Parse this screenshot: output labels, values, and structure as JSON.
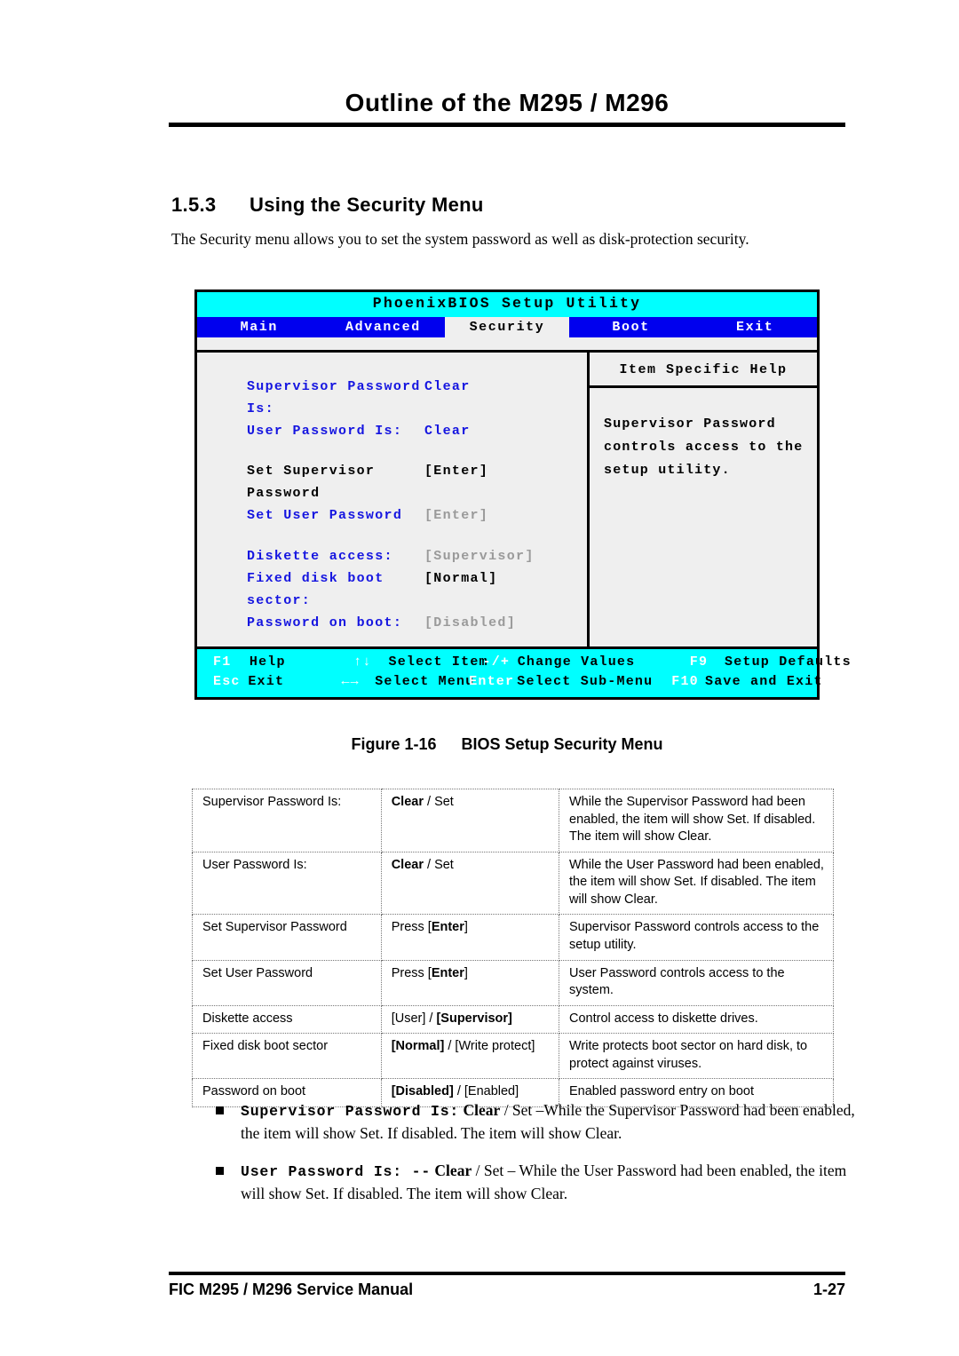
{
  "header": {
    "title": "Outline of the M295 / M296"
  },
  "section": {
    "number": "1.5.3",
    "heading": "Using the Security Menu",
    "intro": "The Security menu allows you to set the system password as well as disk-protection security."
  },
  "bios": {
    "utility_title": "PhoenixBIOS Setup Utility",
    "tabs": [
      {
        "label": "Main",
        "active": false
      },
      {
        "label": "Advanced",
        "active": false
      },
      {
        "label": "Security",
        "active": true
      },
      {
        "label": "Boot",
        "active": false
      },
      {
        "label": "Exit",
        "active": false
      }
    ],
    "items": [
      {
        "label": "Supervisor Password Is:",
        "value": "Clear",
        "label_color": "blue",
        "value_color": "blue"
      },
      {
        "label": "User Password Is:",
        "value": "Clear",
        "label_color": "blue",
        "value_color": "blue"
      },
      {
        "label": "Set Supervisor Password",
        "value": "[Enter]",
        "label_color": "black",
        "value_color": "black"
      },
      {
        "label": "Set User Password",
        "value": "[Enter]",
        "label_color": "blue",
        "value_color": "gray"
      },
      {
        "label": "Diskette access:",
        "value": "[Supervisor]",
        "label_color": "blue",
        "value_color": "gray"
      },
      {
        "label": "Fixed disk boot sector:",
        "value": "[Normal]",
        "label_color": "blue",
        "value_color": "black"
      },
      {
        "label": "Password on boot:",
        "value": "[Disabled]",
        "label_color": "blue",
        "value_color": "gray"
      }
    ],
    "help": {
      "title": "Item Specific Help",
      "lines": [
        "Supervisor Password",
        "controls access to the",
        "setup utility."
      ]
    },
    "fkeys": {
      "row1": [
        {
          "key": "F1",
          "desc": "Help"
        },
        {
          "key": "↑↓",
          "desc": "Select Item"
        },
        {
          "key": "-/+",
          "desc": "Change Values"
        },
        {
          "key": "F9",
          "desc": "Setup Defaults"
        }
      ],
      "row2": [
        {
          "key": "Esc",
          "desc": "Exit"
        },
        {
          "key": "←→",
          "desc": "Select Menu"
        },
        {
          "key": "Enter",
          "desc": "Select Sub-Menu"
        },
        {
          "key": "F10",
          "desc": "Save and Exit"
        }
      ]
    },
    "colors": {
      "title_bg": "#00ffff",
      "tab_bg": "#0000ee",
      "tab_active_bg": "#efefef",
      "panel_bg": "#efefef",
      "item_blue": "#1515e0",
      "item_gray": "#9a9a9a",
      "fkey_bg": "#00ffff"
    }
  },
  "figure": {
    "number": "Figure 1-16",
    "caption": "BIOS Setup Security Menu"
  },
  "table": {
    "rows": [
      {
        "item": "Supervisor Password Is:",
        "options_html": "<b>Clear</b> / Set",
        "description": "While the Supervisor Password had been enabled, the item will show Set. If disabled. The item will show Clear."
      },
      {
        "item": "User Password Is:",
        "options_html": "<b>Clear</b> / Set",
        "description": "While the User Password had been enabled, the item will show Set. If disabled. The item will show Clear."
      },
      {
        "item": "Set Supervisor Password",
        "options_html": "Press [<b>Enter</b>]",
        "description": "Supervisor Password controls access to the setup utility."
      },
      {
        "item": "Set User Password",
        "options_html": "Press [<b>Enter</b>]",
        "description": "User Password controls access to the system."
      },
      {
        "item": "Diskette access",
        "options_html": "[User] / <b>[Supervisor]</b>",
        "description": "Control access to diskette drives."
      },
      {
        "item": "Fixed disk boot sector",
        "options_html": "<b>[Normal]</b> / [Write protect]",
        "description": "Write protects boot sector on hard disk, to protect against viruses."
      },
      {
        "item": "Password on boot",
        "options_html": "<b>[Disabled]</b> / [Enabled]",
        "description": "Enabled password entry on boot"
      }
    ]
  },
  "bullets": [
    {
      "mono": "Supervisor Password Is:",
      "bold": "Clear",
      "rest": " / Set –While the Supervisor Password had been enabled, the item will show Set. If disabled. The item will show Clear."
    },
    {
      "mono": "User Password Is: --",
      "bold": "Clear",
      "rest": " / Set – While the User Password had been enabled, the item will show Set. If disabled. The item will show Clear."
    }
  ],
  "footer": {
    "manual": "FIC M295 / M296 Service Manual",
    "page": "1-27"
  }
}
